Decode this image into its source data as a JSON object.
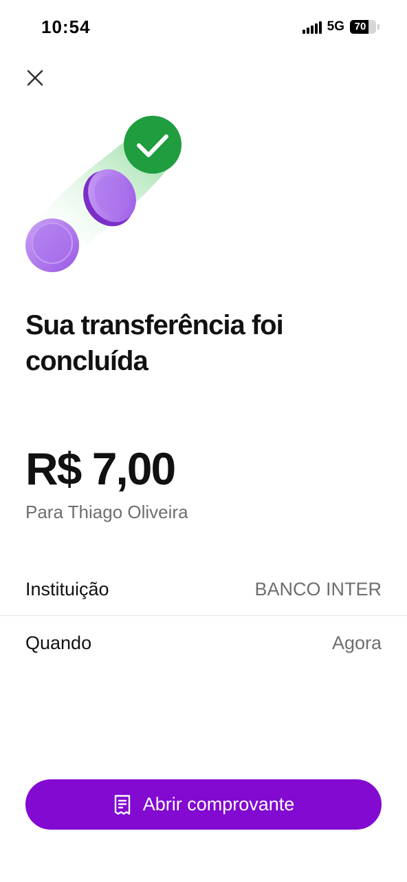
{
  "status_bar": {
    "time": "10:54",
    "network": "5G",
    "battery": "70",
    "battery_level_percent": 70
  },
  "header": {
    "close_icon": "close-icon"
  },
  "hero": {
    "icons": [
      "check-circle-icon",
      "coin-icon"
    ],
    "colors": {
      "check": "#1f9d3f",
      "coin": "#a46be8",
      "trail": "#bfe9c4"
    }
  },
  "title": "Sua transferência foi concluída",
  "amount": "R$ 7,00",
  "recipient": "Para Thiago Oliveira",
  "details": [
    {
      "label": "Instituição",
      "value": "BANCO INTER"
    },
    {
      "label": "Quando",
      "value": "Agora"
    }
  ],
  "actions": {
    "receipt_button_label": "Abrir comprovante",
    "receipt_icon": "receipt-icon",
    "accent": "#820ad1"
  }
}
